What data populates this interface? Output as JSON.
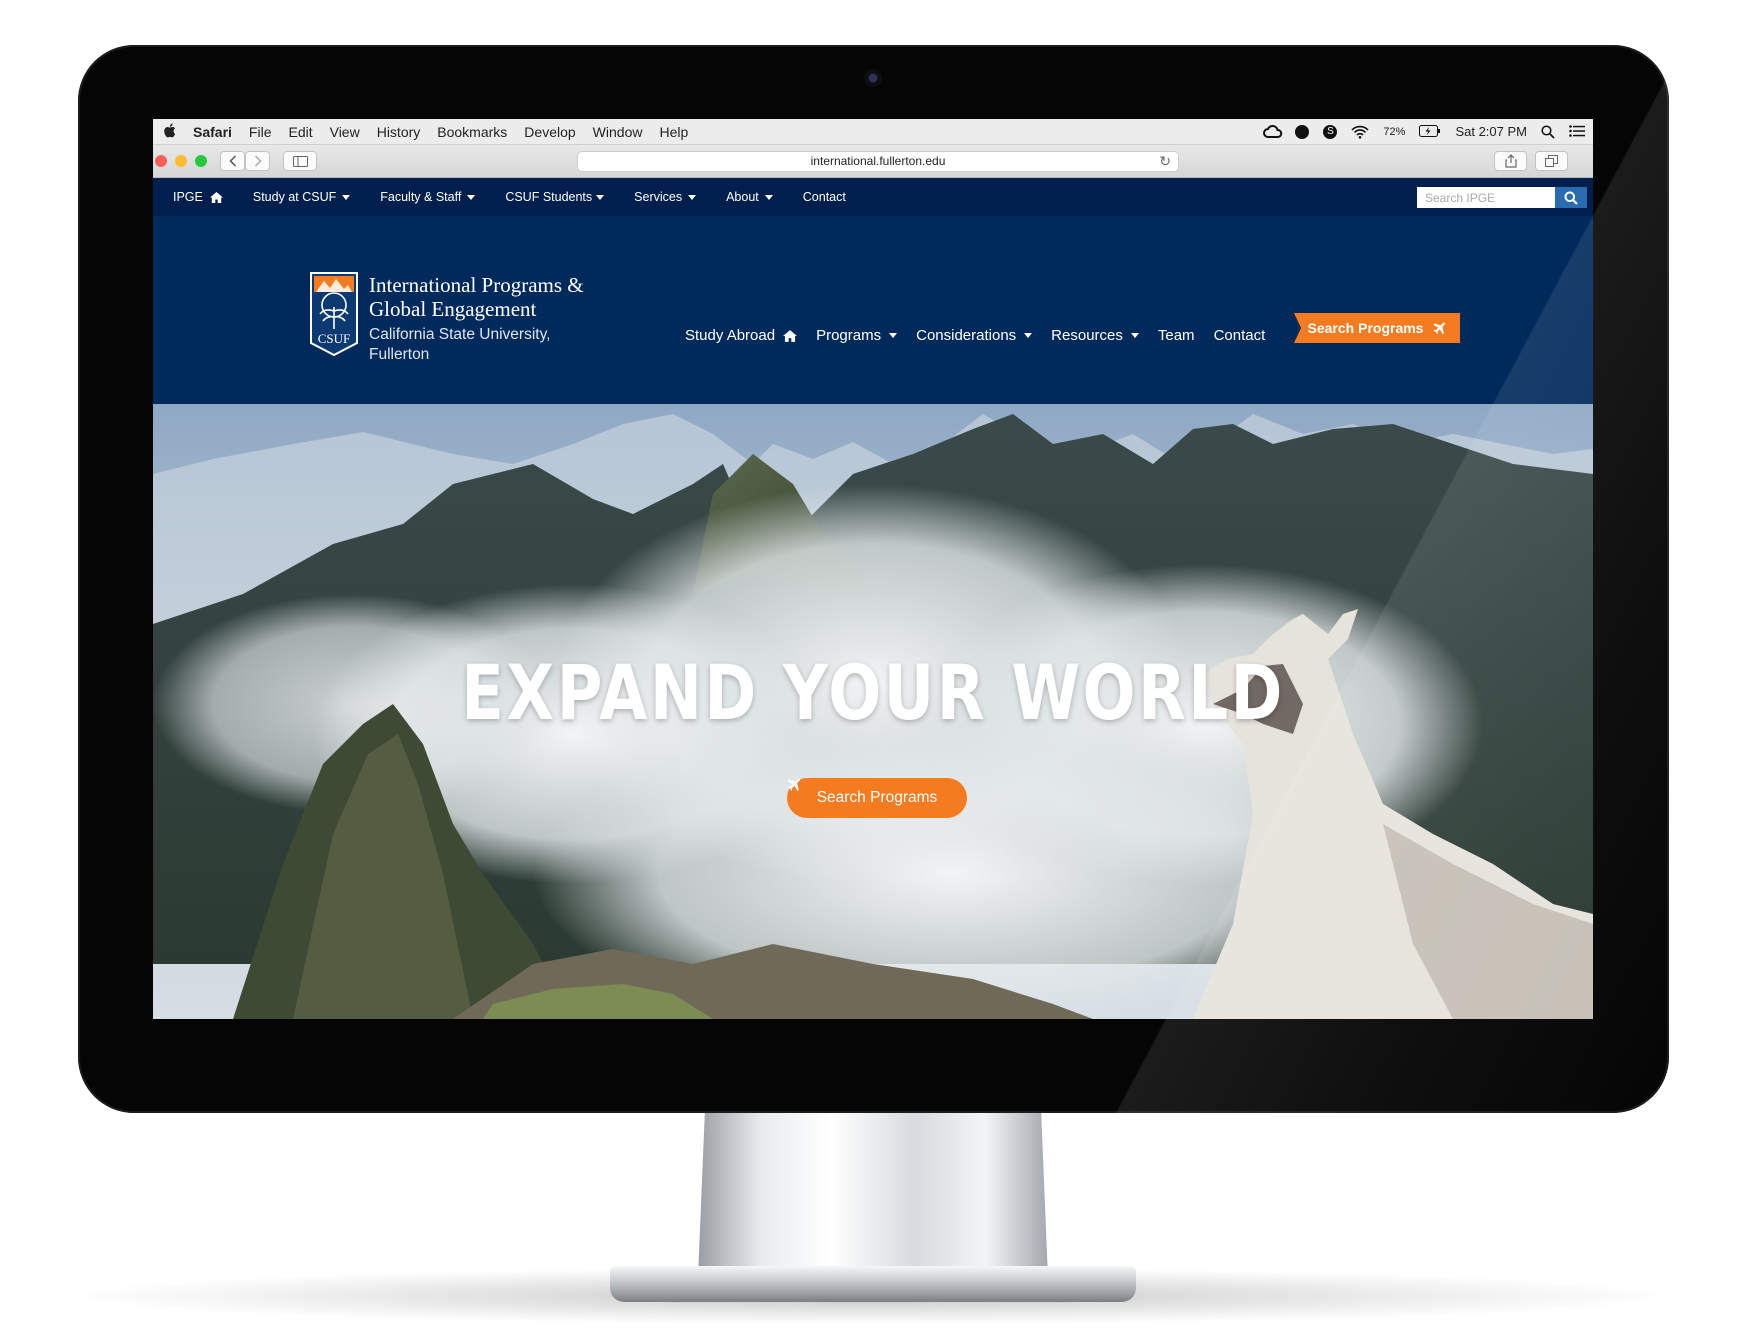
{
  "menubar": {
    "app": "Safari",
    "items": [
      "File",
      "Edit",
      "View",
      "History",
      "Bookmarks",
      "Develop",
      "Window",
      "Help"
    ],
    "battery": "72%",
    "clock": "Sat 2:07 PM"
  },
  "browser": {
    "url": "international.fullerton.edu"
  },
  "utility_nav": {
    "items": [
      "IPGE",
      "Study at CSUF",
      "Faculty & Staff",
      "CSUF Students",
      "Services",
      "About",
      "Contact"
    ],
    "search_placeholder": "Search IPGE"
  },
  "header": {
    "logo_text": "CSUF",
    "title": "International Programs & Global Engagement",
    "subtitle": "California State University, Fullerton",
    "nav": [
      "Study Abroad",
      "Programs",
      "Considerations",
      "Resources",
      "Team",
      "Contact"
    ],
    "cta": "Search Programs"
  },
  "hero": {
    "heading": "EXPAND YOUR WORLD",
    "button": "Search Programs"
  },
  "colors": {
    "navy": "#002a5c",
    "utility_navy": "#001f4d",
    "orange": "#f47b1f"
  }
}
